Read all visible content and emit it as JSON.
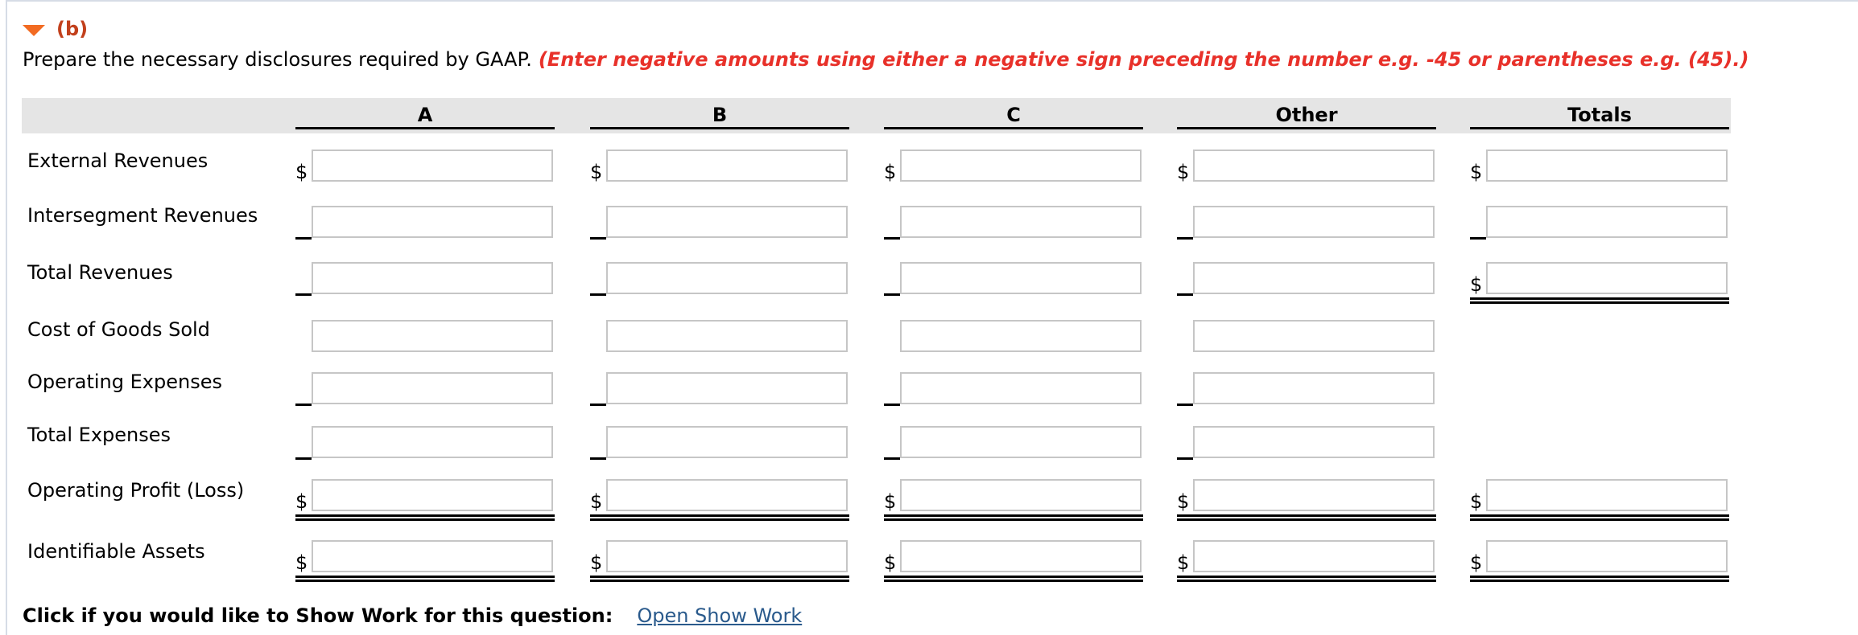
{
  "part": {
    "label": "(b)",
    "icon": "collapse-triangle-icon"
  },
  "instructions": {
    "text": "Prepare the necessary disclosures required by GAAP.",
    "note": "(Enter negative amounts using either a negative sign preceding the number e.g. -45 or parentheses e.g. (45).)"
  },
  "colors": {
    "accent_orange": "#f26b22",
    "part_label": "#c2401c",
    "note_red": "#e8312a",
    "link": "#2a5a8c",
    "header_band": "#e5e5e5"
  },
  "table": {
    "columns": [
      "A",
      "B",
      "C",
      "Other",
      "Totals"
    ],
    "rows": [
      {
        "label": "External Revenues",
        "prefixes": [
          "$",
          "$",
          "$",
          "$",
          "$"
        ],
        "values": [
          "",
          "",
          "",
          "",
          ""
        ]
      },
      {
        "label": "Intersegment Revenues",
        "prefixes": [
          "_",
          "_",
          "_",
          "_",
          "_"
        ],
        "values": [
          "",
          "",
          "",
          "",
          ""
        ]
      },
      {
        "label": "Total Revenues",
        "prefixes": [
          "_",
          "_",
          "_",
          "_",
          "$"
        ],
        "values": [
          "",
          "",
          "",
          "",
          ""
        ]
      },
      {
        "label": "Cost of Goods Sold",
        "prefixes": [
          "",
          "",
          "",
          ""
        ],
        "values": [
          "",
          "",
          "",
          ""
        ]
      },
      {
        "label": "Operating Expenses",
        "prefixes": [
          "_",
          "_",
          "_",
          "_"
        ],
        "values": [
          "",
          "",
          "",
          ""
        ]
      },
      {
        "label": "Total Expenses",
        "prefixes": [
          "_",
          "_",
          "_",
          "_"
        ],
        "values": [
          "",
          "",
          "",
          ""
        ]
      },
      {
        "label": "Operating Profit (Loss)",
        "prefixes": [
          "$",
          "$",
          "$",
          "$",
          "$"
        ],
        "values": [
          "",
          "",
          "",
          "",
          ""
        ]
      },
      {
        "label": "Identifiable Assets",
        "prefixes": [
          "$",
          "$",
          "$",
          "$",
          "$"
        ],
        "values": [
          "",
          "",
          "",
          "",
          ""
        ]
      }
    ]
  },
  "footer": {
    "prompt": "Click if you would like to Show Work for this question:",
    "link": "Open Show Work"
  }
}
